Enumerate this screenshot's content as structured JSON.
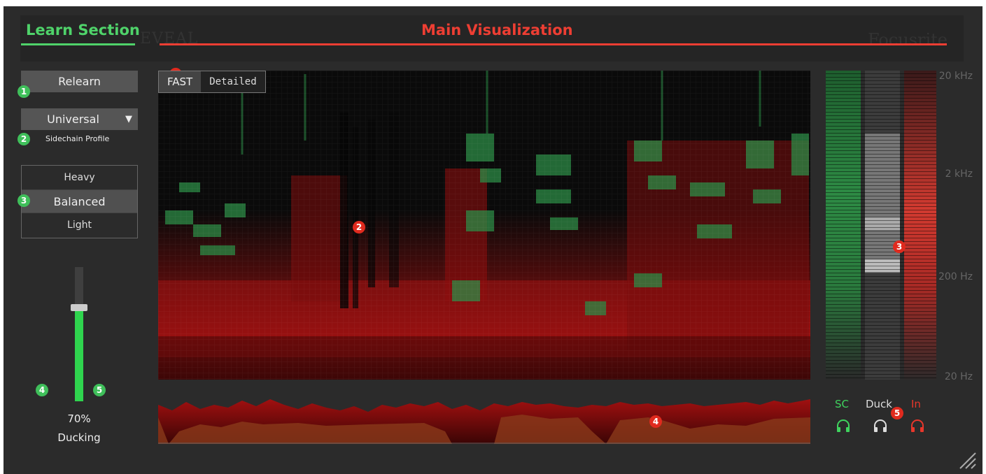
{
  "header": {
    "learn_section_label": "Learn Section",
    "main_visualization_label": "Main Visualization",
    "ghost_logo": "EVEAL",
    "ghost_brand": "Focusrite",
    "colors": {
      "learn": "#4fd36a",
      "main": "#ee3e33"
    }
  },
  "learn": {
    "relearn_label": "Relearn",
    "profile_value": "Universal",
    "profile_label": "Sidechain Profile",
    "amount_options": [
      "Heavy",
      "Balanced",
      "Light"
    ],
    "amount_selected": "Balanced"
  },
  "ducking": {
    "value_text": "70%",
    "label": "Ducking",
    "level": 0.7
  },
  "speed_toggle": {
    "options": [
      "FAST",
      "Detailed"
    ],
    "selected": "FAST"
  },
  "meters": {
    "freq_labels": [
      "20 kHz",
      "2 kHz",
      "200 Hz",
      "20 Hz"
    ],
    "channels": [
      {
        "label": "SC",
        "color": "#3fd35e",
        "icon": "headphones-icon"
      },
      {
        "label": "Duck",
        "color": "#dddddd",
        "icon": "headphones-icon"
      },
      {
        "label": "In",
        "color": "#e8372b",
        "icon": "headphones-icon"
      }
    ]
  },
  "badges": {
    "green": [
      "1",
      "2",
      "3",
      "4",
      "5"
    ],
    "red": [
      "1",
      "2",
      "3",
      "4",
      "5"
    ]
  }
}
